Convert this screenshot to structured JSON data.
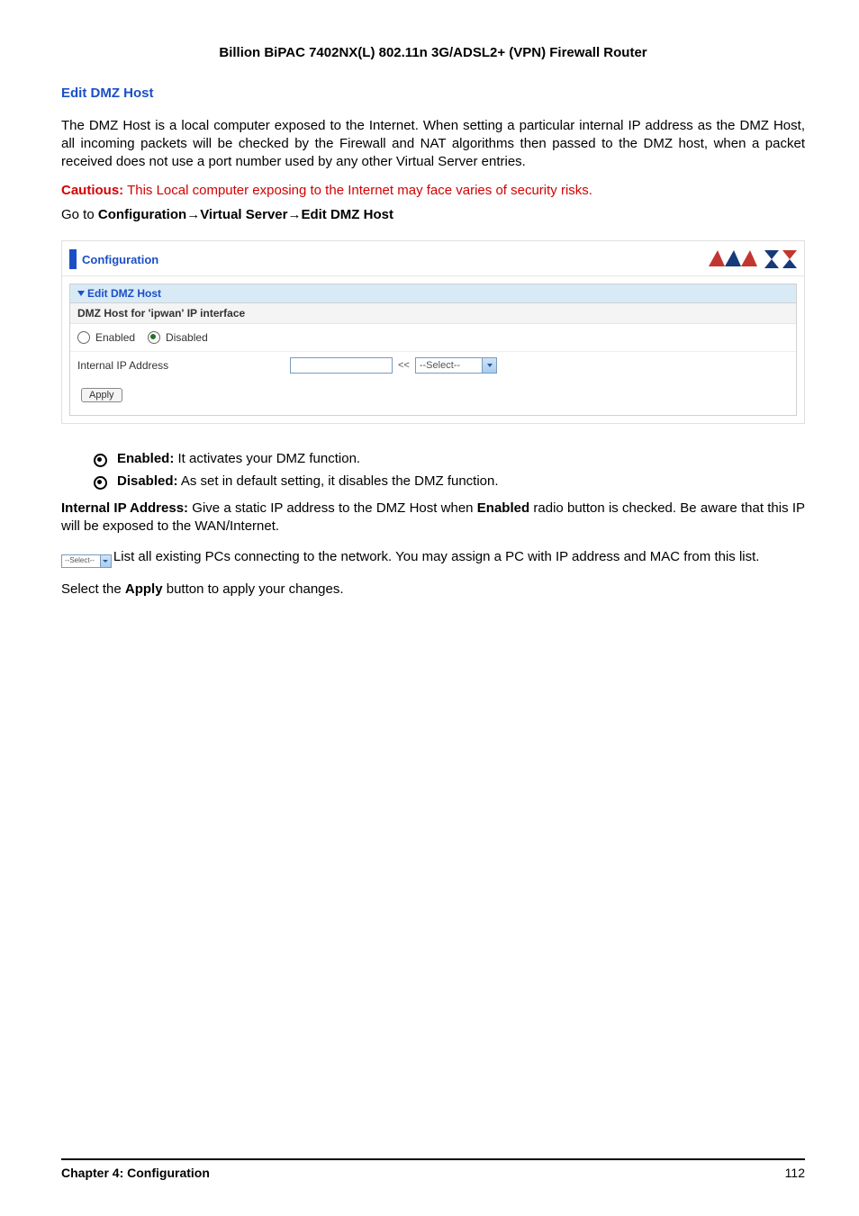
{
  "header": {
    "product_title": "Billion BiPAC 7402NX(L) 802.11n 3G/ADSL2+ (VPN) Firewall Router"
  },
  "section": {
    "heading": "Edit DMZ Host",
    "description": "The DMZ Host is a local computer exposed to the Internet. When setting a particular internal IP address as the DMZ Host, all incoming packets will be checked by the Firewall and NAT algorithms then passed to the DMZ host, when a packet received does not use a port number used by any other Virtual Server entries.",
    "caution_label": "Cautious:",
    "caution_text": " This Local computer exposing to the Internet may face varies of security risks.",
    "nav_prefix": "Go to ",
    "nav_part1": "Configuration",
    "nav_part2": "Virtual Server",
    "nav_part3": "Edit DMZ Host"
  },
  "ui": {
    "page_title": "Configuration",
    "panel_title": "Edit DMZ Host",
    "subheader": "DMZ Host for 'ipwan' IP interface",
    "radio_enabled": "Enabled",
    "radio_disabled": "Disabled",
    "row_ip_label": "Internal IP Address",
    "laquo": "<<",
    "select_value": "--Select--",
    "apply_label": "Apply"
  },
  "bullets": {
    "enabled_label": "Enabled:",
    "enabled_text": " It activates your DMZ function.",
    "disabled_label": "Disabled:",
    "disabled_text": " As set in default setting, it disables the DMZ function."
  },
  "body": {
    "ip_label": "Internal IP Address:",
    "ip_text": "   Give a static IP address to the DMZ Host when ",
    "ip_bold": "Enabled",
    "ip_text2": " radio button is checked. Be aware that this IP will be exposed to the WAN/Internet.",
    "inline_select_value": "--Select--",
    "list_text": "List all existing PCs connecting to the network. You may assign a PC with IP address and MAC from this list.",
    "apply_prefix": "Select the ",
    "apply_bold": "Apply",
    "apply_suffix": " button to apply your changes."
  },
  "footer": {
    "chapter": "Chapter 4: Configuration",
    "page_number": "112"
  }
}
